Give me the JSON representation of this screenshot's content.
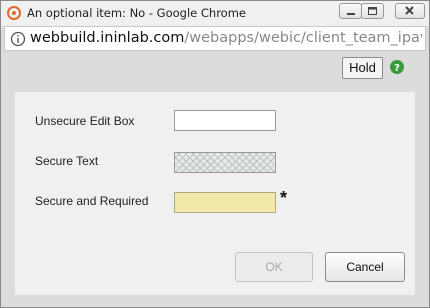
{
  "window": {
    "title": "An optional item: No - Google Chrome"
  },
  "address_bar": {
    "host": "webbuild.ininlab.com",
    "path": "/webapps/webic/client_team_ipaviews/..."
  },
  "toolbar": {
    "hold_label": "Hold"
  },
  "form": {
    "fields": [
      {
        "label": "Unsecure Edit Box",
        "value": ""
      },
      {
        "label": "Secure Text",
        "value": ""
      },
      {
        "label": "Secure and Required",
        "value": "",
        "required_marker": "*"
      }
    ]
  },
  "buttons": {
    "ok_label": "OK",
    "cancel_label": "Cancel"
  },
  "colors": {
    "required_field": "#f1e8a9",
    "help_icon": "#3a9a3a",
    "app_icon": "#e06a2a"
  }
}
